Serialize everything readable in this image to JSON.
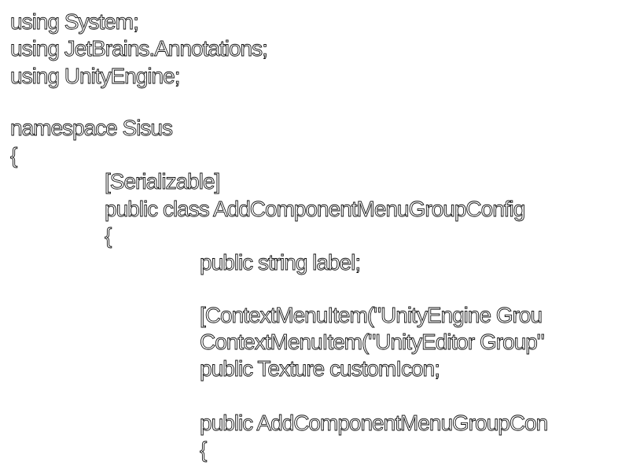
{
  "code": {
    "lines": [
      "using System;",
      "using JetBrains.Annotations;",
      "using UnityEngine;",
      "",
      "namespace Sisus",
      "{",
      "[Serializable]",
      "public class AddComponentMenuGroupConfig",
      "{",
      "public string label;",
      "",
      "[ContextMenuItem(\"UnityEngine Grou",
      "ContextMenuItem(\"UnityEditor Group\"",
      "public Texture customIcon;",
      "",
      "public AddComponentMenuGroupCon",
      "{"
    ]
  }
}
